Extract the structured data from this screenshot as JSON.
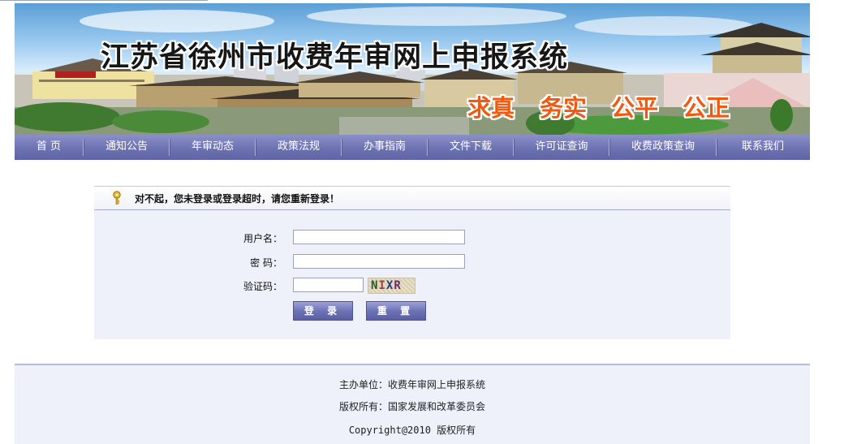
{
  "banner": {
    "title": "江苏省徐州市收费年审网上申报系统",
    "slogans": [
      "求真",
      "务实",
      "公平",
      "公正"
    ]
  },
  "nav": {
    "items": [
      "首  页",
      "通知公告",
      "年审动态",
      "政策法规",
      "办事指南",
      "文件下载",
      "许可证查询",
      "收费政策查询",
      "联系我们"
    ]
  },
  "login": {
    "message": "对不起，您未登录或登录超时，请您重新登录！",
    "username_label": "用户名：",
    "username_value": "",
    "password_label": "密  码：",
    "password_value": "",
    "captcha_label": "验证码：",
    "captcha_value": "",
    "captcha_text": [
      "N",
      "I",
      "X",
      "R"
    ],
    "login_button": "登 录",
    "reset_button": "重 置"
  },
  "footer": {
    "sponsor": "主办单位：收费年审网上申报系统",
    "copyright_owner": "版权所有：国家发展和改革委员会",
    "copyright": "Copyright@2010 版权所有"
  }
}
